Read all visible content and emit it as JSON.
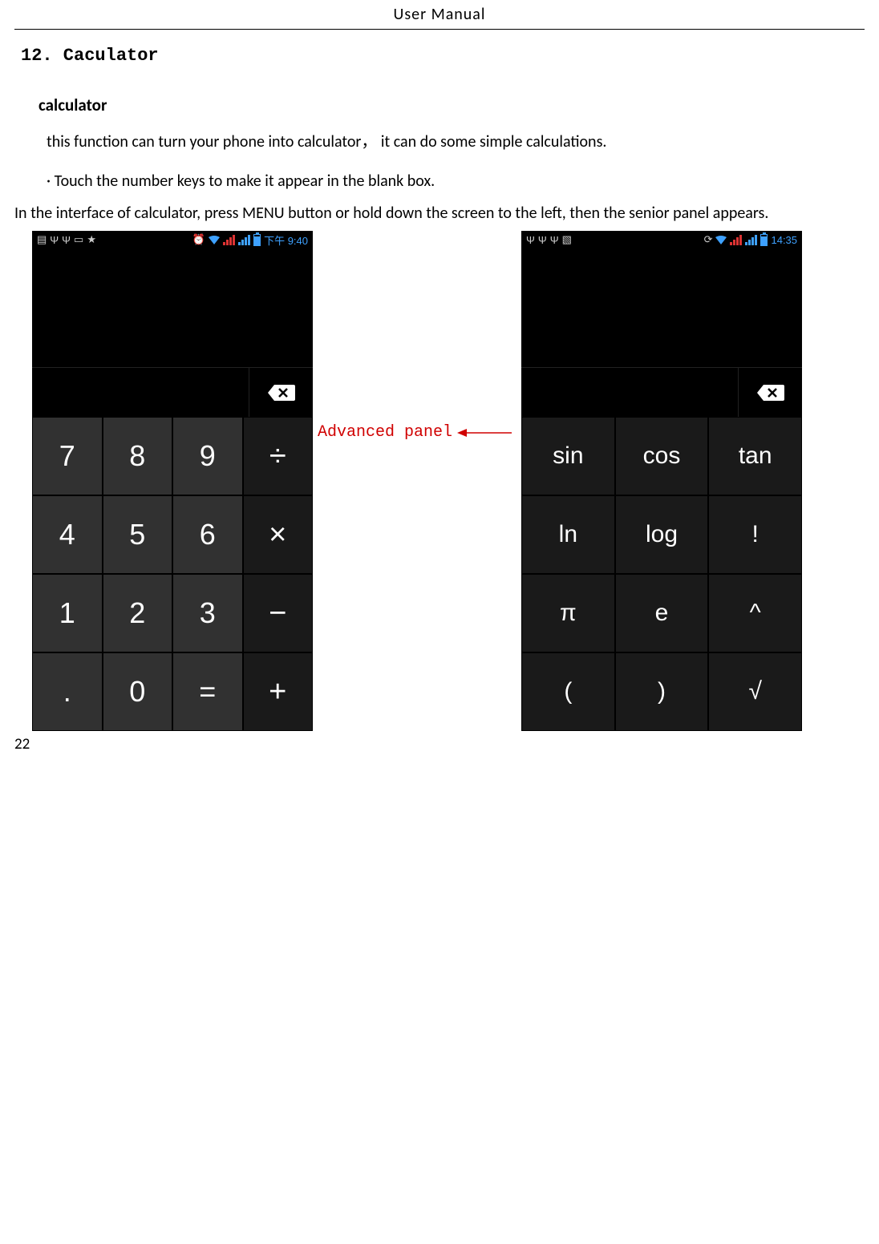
{
  "header": {
    "title": "User    Manual"
  },
  "section": {
    "heading": "12. Caculator",
    "subheading": "calculator",
    "desc": "this function can turn your phone into calculator，   it can do some simple calculations.",
    "bullet_prefix": "·",
    "bullet": "Touch the number keys to make it appear in the blank box.",
    "full_line": "In the interface of calculator, press MENU button or hold down the screen to the left, then the senior panel appears."
  },
  "annotation": "Advanced panel",
  "screenshot_basic": {
    "status_time": "下午 9:40",
    "keys": [
      [
        "7",
        "8",
        "9",
        "÷"
      ],
      [
        "4",
        "5",
        "6",
        "×"
      ],
      [
        "1",
        "2",
        "3",
        "−"
      ],
      [
        ".",
        "0",
        "=",
        "+"
      ]
    ]
  },
  "screenshot_advanced": {
    "status_time": "14:35",
    "keys": [
      [
        "sin",
        "cos",
        "tan"
      ],
      [
        "ln",
        "log",
        "!"
      ],
      [
        "π",
        "e",
        "^"
      ],
      [
        "(",
        ")",
        "√"
      ]
    ]
  },
  "page_number": "22"
}
